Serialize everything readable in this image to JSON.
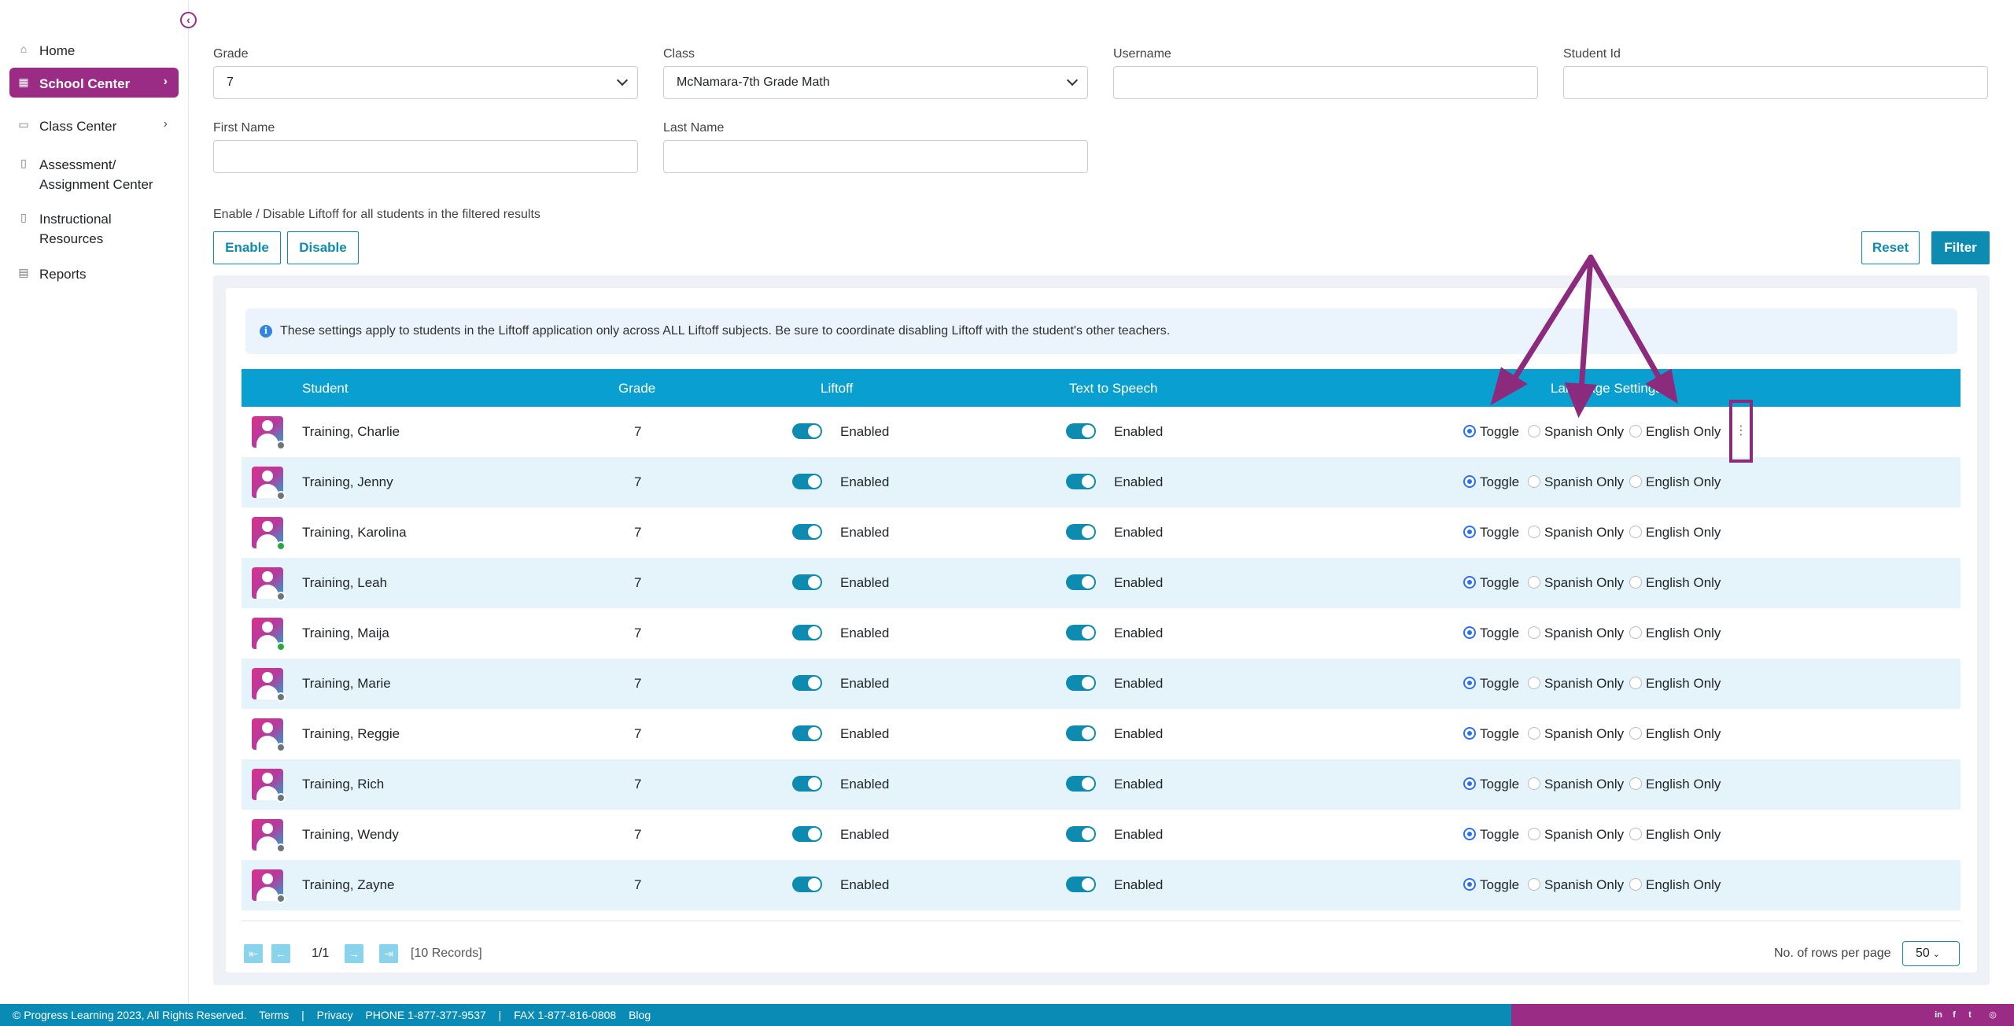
{
  "sidebar": {
    "items": [
      {
        "label": "Home",
        "icon": "home-icon"
      },
      {
        "label": "School Center",
        "icon": "school-icon",
        "active": true
      },
      {
        "label": "Class Center",
        "icon": "class-icon"
      },
      {
        "label": "Assessment/\nAssignment Center",
        "icon": "book-icon"
      },
      {
        "label": "Instructional\nResources",
        "icon": "book-open-icon"
      },
      {
        "label": "Reports",
        "icon": "report-icon"
      }
    ]
  },
  "filters": {
    "grade_label": "Grade",
    "grade_value": "7",
    "class_label": "Class",
    "class_value": "McNamara-7th Grade Math",
    "username_label": "Username",
    "username_value": "",
    "studentid_label": "Student Id",
    "studentid_value": "",
    "firstname_label": "First Name",
    "firstname_value": "",
    "lastname_label": "Last Name",
    "lastname_value": ""
  },
  "bulk": {
    "text": "Enable / Disable Liftoff for all students in the filtered results",
    "enable_label": "Enable",
    "disable_label": "Disable"
  },
  "actions": {
    "reset_label": "Reset",
    "filter_label": "Filter"
  },
  "info": {
    "text": "These settings apply to students in the Liftoff application only across ALL Liftoff subjects. Be sure to coordinate disabling Liftoff with the student's other teachers."
  },
  "table": {
    "headers": {
      "student": "Student",
      "grade": "Grade",
      "liftoff": "Liftoff",
      "tts": "Text to Speech",
      "language": "Language Settings"
    },
    "options": {
      "toggle": "Toggle",
      "spanish": "Spanish Only",
      "english": "English Only"
    },
    "rows": [
      {
        "name": "Training, Charlie",
        "grade": "7",
        "liftoff": "Enabled",
        "tts": "Enabled",
        "status": "#6c757d"
      },
      {
        "name": "Training, Jenny",
        "grade": "7",
        "liftoff": "Enabled",
        "tts": "Enabled",
        "status": "#6c757d"
      },
      {
        "name": "Training, Karolina",
        "grade": "7",
        "liftoff": "Enabled",
        "tts": "Enabled",
        "status": "#28a745"
      },
      {
        "name": "Training, Leah",
        "grade": "7",
        "liftoff": "Enabled",
        "tts": "Enabled",
        "status": "#6c757d"
      },
      {
        "name": "Training, Maija",
        "grade": "7",
        "liftoff": "Enabled",
        "tts": "Enabled",
        "status": "#28a745"
      },
      {
        "name": "Training, Marie",
        "grade": "7",
        "liftoff": "Enabled",
        "tts": "Enabled",
        "status": "#6c757d"
      },
      {
        "name": "Training, Reggie",
        "grade": "7",
        "liftoff": "Enabled",
        "tts": "Enabled",
        "status": "#6c757d"
      },
      {
        "name": "Training, Rich",
        "grade": "7",
        "liftoff": "Enabled",
        "tts": "Enabled",
        "status": "#6c757d"
      },
      {
        "name": "Training, Wendy",
        "grade": "7",
        "liftoff": "Enabled",
        "tts": "Enabled",
        "status": "#6c757d"
      },
      {
        "name": "Training, Zayne",
        "grade": "7",
        "liftoff": "Enabled",
        "tts": "Enabled",
        "status": "#6c757d"
      }
    ]
  },
  "pager": {
    "page": "1/1",
    "records": "[10 Records]",
    "rows_label": "No. of rows per page",
    "rows_value": "50"
  },
  "footer": {
    "copyright": "© Progress Learning 2023, All Rights Reserved.",
    "terms": "Terms",
    "sep1": "|",
    "privacy": "Privacy",
    "phone": "PHONE 1-877-377-9537",
    "sep2": "|",
    "fax": "FAX 1-877-816-0808",
    "blog": "Blog"
  },
  "colors": {
    "brand_purple": "#9b2c86",
    "brand_blue": "#0a9fd1",
    "annotation": "#8c2a7d"
  }
}
